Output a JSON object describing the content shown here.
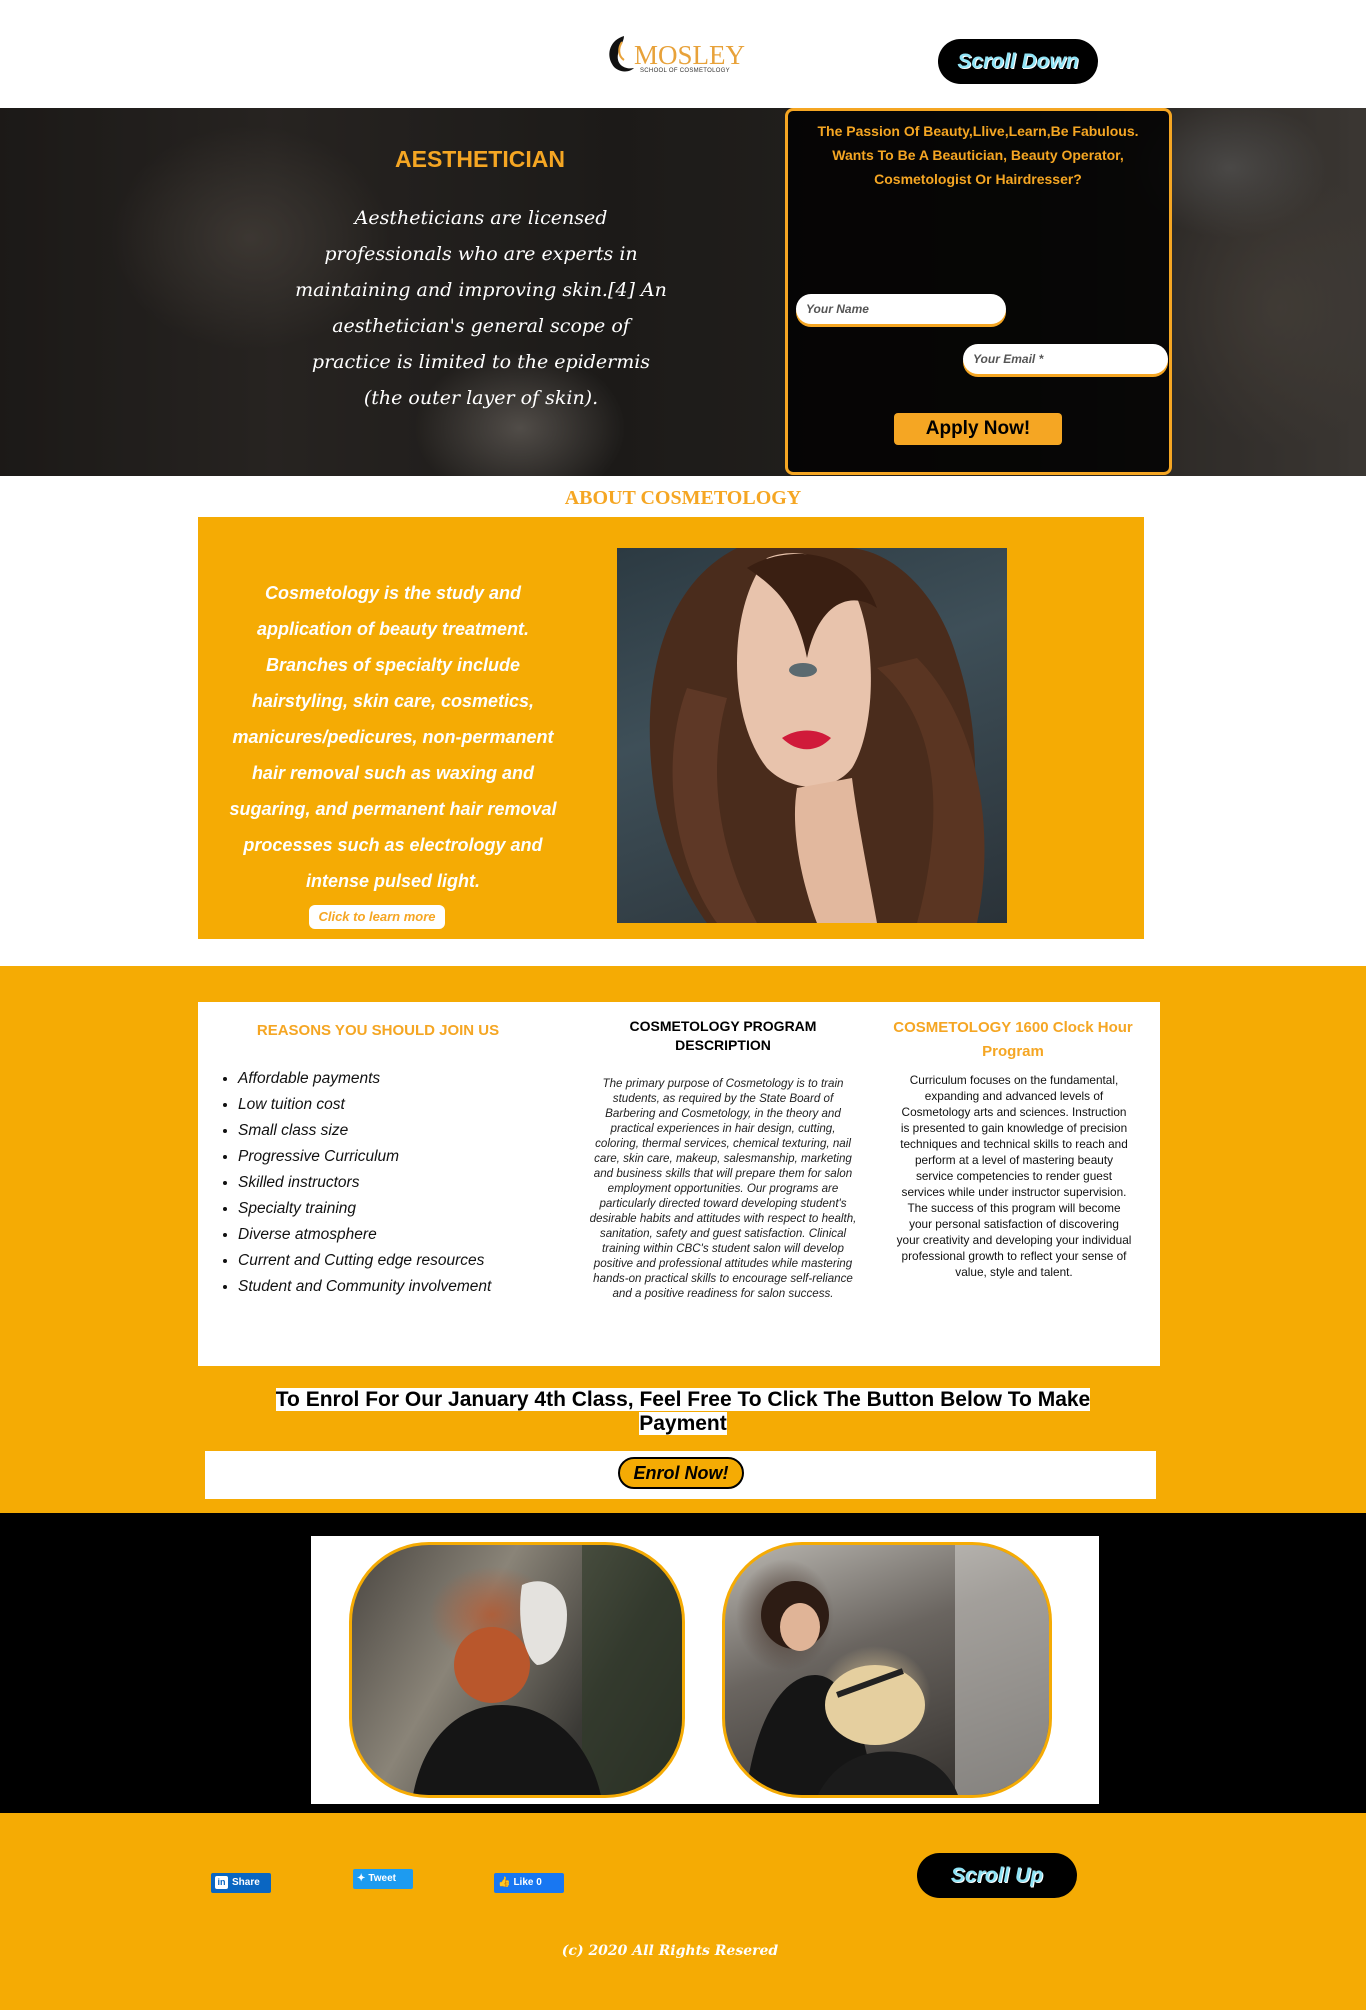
{
  "header": {
    "logo_text": "MOSLEY",
    "logo_sub": "SCHOOL OF COSMETOLOGY",
    "scroll_down_label": "Scroll Down"
  },
  "hero": {
    "title": "AESTHETICIAN",
    "text": "Aestheticians are licensed professionals who are experts in maintaining and improving skin.[4] An aesthetician's general scope of practice is limited to the epidermis (the outer layer of skin).",
    "form": {
      "heading_line1": "The Passion Of Beauty,Llive,Learn,Be Fabulous.",
      "heading_line2": "Wants To Be A Beautician, Beauty Operator, Cosmetologist Or Hairdresser?",
      "name_placeholder": "Your Name",
      "email_placeholder": "Your Email *",
      "apply_label": "Apply Now!"
    }
  },
  "about": {
    "title": "ABOUT COSMETOLOGY",
    "text": "Cosmetology is the study and application of beauty treatment. Branches of specialty include hairstyling, skin care, cosmetics, manicures/pedicures, non-permanent hair removal such as waxing and sugaring, and permanent hair removal processes such as electrology and intense pulsed light.",
    "learn_more_label": "Click to learn more"
  },
  "reasons": {
    "title": "REASONS YOU SHOULD JOIN US",
    "items": [
      "Affordable payments",
      "Low tuition cost",
      "Small class size",
      "Progressive Curriculum",
      "Skilled instructors",
      "Specialty training",
      "Diverse atmosphere",
      "Current and Cutting edge resources",
      "Student and Community involvement"
    ]
  },
  "program": {
    "title": "COSMETOLOGY PROGRAM DESCRIPTION",
    "text": "The primary purpose of Cosmetology is to train students, as required by the State Board of Barbering and Cosmetology, in the theory and practical experiences in hair design, cutting, coloring, thermal services, chemical texturing, nail care, skin care, makeup, salesmanship, marketing and business skills that will prepare them for salon employment opportunities. Our programs are particularly directed toward developing student's desirable habits and attitudes with respect to health, sanitation, safety and guest satisfaction. Clinical training within CBC's student salon will develop positive and professional attitudes while mastering hands-on practical skills to encourage self-reliance and a positive readiness for salon success."
  },
  "clock_hour": {
    "title": "COSMETOLOGY 1600 Clock Hour Program",
    "text1": "Curriculum focuses on the fundamental, expanding and advanced levels of Cosmetology arts and sciences. Instruction is presented to gain knowledge of precision techniques and technical skills to reach and perform at a level of mastering beauty service competencies to render guest services while under instructor supervision.",
    "text2": "The success of this program will become your personal satisfaction of discovering your creativity and developing your individual professional growth to reflect your sense of value, style and talent."
  },
  "enrol": {
    "heading": "To Enrol For Our January 4th Class, Feel Free To Click The Button Below To Make Payment",
    "button_label": "Enrol Now!"
  },
  "footer": {
    "share_label": "Share",
    "tweet_label": "Tweet",
    "like_label": "Like 0",
    "scroll_up_label": "Scroll Up",
    "copyright": "(c) 2020 All Rights Resered"
  },
  "colors": {
    "accent": "#f5ab04",
    "accent_text": "#f5a623",
    "dark": "#000000",
    "scroll_button_text": "#8fe3f5"
  }
}
